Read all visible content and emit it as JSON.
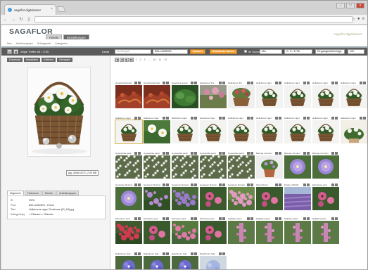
{
  "browser": {
    "tab_title": "sagaflor.digitalasset",
    "url": "",
    "controls": [
      "–",
      "□",
      "×"
    ]
  },
  "brand": {
    "logo": "SAGAFLOR",
    "logo_sub": "",
    "right_mark": "sagaflor.digitalasset"
  },
  "main_tabs": [
    {
      "label": "Assets",
      "active": true
    },
    {
      "label": "Einstellungen",
      "active": false
    }
  ],
  "subnav": [
    "Neu",
    "Arbeitsmappen",
    "Schlagworte",
    "Kategorien"
  ],
  "toolbar": {
    "hits": "Zeige Treffer 65 / 1730",
    "detail": "Detail",
    "search_placeholder": "Suchbegriff",
    "search_value": "BELLANDRIS",
    "search_button": "Suchen",
    "advanced_button": "Erweiterte Suche",
    "within_results": "im Suchergebnis suchen",
    "sort_select": "Mix",
    "range_text": "2 / 3 / 1730",
    "order_select": "Eingangsreihenfolge",
    "per_page": "100"
  },
  "actions": [
    "Download",
    "Metadaten",
    "Editieren",
    "Übergabe"
  ],
  "preview": {
    "dims": "jpg, 2848×4272, 2.90 MB"
  },
  "info_tabs": [
    {
      "label": "Allgemein",
      "active": true
    },
    {
      "label": "Technisch",
      "active": false
    },
    {
      "label": "Rechte",
      "active": false
    },
    {
      "label": "Arbeitsmappen",
      "active": false
    }
  ],
  "info": [
    {
      "k": "ID",
      "v": "2576"
    },
    {
      "k": "Pool",
      "v": "BELLANDRIS - Erlern"
    },
    {
      "k": "Titel",
      "v": "Helleborus niger Christrose (IG_84).jpg"
    },
    {
      "k": "Kategorie(n)",
      "v": "> Pflanzen > Stauden"
    }
  ],
  "pager": {
    "buttons": [
      "|◀",
      "◀",
      "▶",
      "▶|"
    ],
    "pages": [
      "1",
      "2",
      "3",
      "...",
      "10",
      "11",
      "12"
    ]
  },
  "grid": [
    {
      "label": "Heucherella tiarel",
      "kind": "red"
    },
    {
      "label": "Heucherella tiarel",
      "kind": "red"
    },
    {
      "label": "Heuchera americ",
      "kind": "green"
    },
    {
      "label": "Helleborus 'Pre",
      "kind": "pink"
    },
    {
      "label": "Helleborus 'Pa",
      "kind": "basketred"
    },
    {
      "label": "Helleborus niger",
      "kind": "basket"
    },
    {
      "label": "Helleborus niger",
      "kind": "basket"
    },
    {
      "label": "Helleborus niger",
      "kind": "basket"
    },
    {
      "label": "Helleborus niger",
      "kind": "basket"
    },
    {
      "label": "Helleborus niger",
      "kind": "basket",
      "selected": true
    },
    {
      "label": "Helleborus niger",
      "kind": "white"
    },
    {
      "label": "Helleborus niger",
      "kind": "basket"
    },
    {
      "label": "Helleborus niger",
      "kind": "basket"
    },
    {
      "label": "Helleborus niger",
      "kind": "basket"
    },
    {
      "label": "Helleborus niger",
      "kind": "basket"
    },
    {
      "label": "Helleborus niger",
      "kind": "basket"
    },
    {
      "label": "Helleborus niger",
      "kind": "basket"
    },
    {
      "label": "Helleborus niger",
      "kind": "whiteplant"
    },
    {
      "label": "Gypsophila panic",
      "kind": "gyps"
    },
    {
      "label": "Gypsophila panic",
      "kind": "gyps"
    },
    {
      "label": "Gypsophila panic",
      "kind": "gyps"
    },
    {
      "label": "Gypsophila panic",
      "kind": "gyps"
    },
    {
      "label": "Gypsophila panic",
      "kind": "gyps"
    },
    {
      "label": "Bacopa monnieri",
      "kind": "purplepot"
    },
    {
      "label": "Bacopa monnieri",
      "kind": "purple"
    },
    {
      "label": "Bacopa monnieri",
      "kind": "purple"
    },
    {
      "label": "",
      "kind": "none"
    },
    {
      "label": "Geranium Rozann",
      "kind": "purple"
    },
    {
      "label": "Geranium Rozann",
      "kind": "mixgreen"
    },
    {
      "label": "Geranium Rozann",
      "kind": "purplebed"
    },
    {
      "label": "Geranium Rozann",
      "kind": "pinkbloom"
    },
    {
      "label": "Geranium Rozann",
      "kind": "pinkfield"
    },
    {
      "label": "Sisyrinchium",
      "kind": "pinkbloom"
    },
    {
      "label": "Purple_STAUD",
      "kind": "lavender"
    },
    {
      "label": "Echinacea purp",
      "kind": "pinkbloom"
    },
    {
      "label": "",
      "kind": "none"
    },
    {
      "label": "Echinacea purp",
      "kind": "redfield"
    },
    {
      "label": "Echinacea purp",
      "kind": "pinkbloom"
    },
    {
      "label": "Echinacea purp",
      "kind": "pinkflat"
    },
    {
      "label": "Echinacea purp",
      "kind": "pinkbloom"
    },
    {
      "label": "Digitalis purpur",
      "kind": "digitalis"
    },
    {
      "label": "Digitalis purpur",
      "kind": "digitalis"
    },
    {
      "label": "Digitalis purpur",
      "kind": "digitalis"
    },
    {
      "label": "Digitalis purpur",
      "kind": "digitalis"
    },
    {
      "label": "",
      "kind": "none"
    },
    {
      "label": "Delphinium hybr",
      "kind": "delph"
    },
    {
      "label": "Delphinium hybr",
      "kind": "delph"
    },
    {
      "label": "Delphinium hybr",
      "kind": "delph"
    },
    {
      "label": "Delphinium hybr",
      "kind": "delphpale"
    }
  ]
}
